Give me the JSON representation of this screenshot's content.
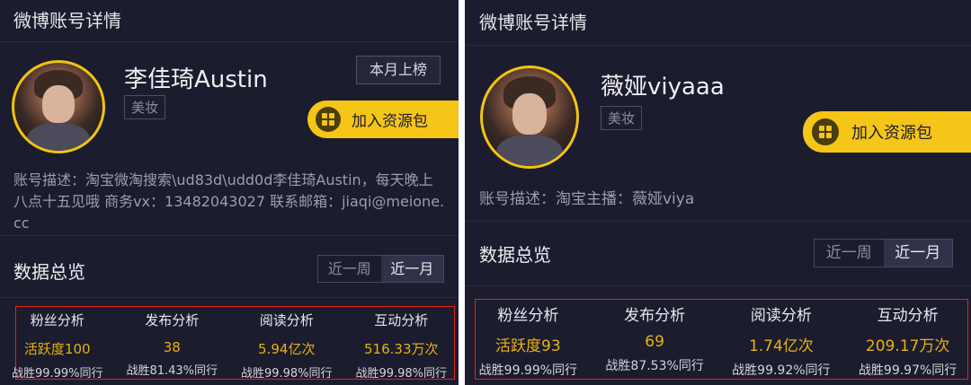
{
  "left": {
    "title": "微博账号详情",
    "name": "李佳琦Austin",
    "tag": "美妆",
    "rank_button": "本月上榜",
    "resource_button": "加入资源包",
    "description": "账号描述：淘宝微淘搜索\\ud83d\\udd0d李佳琦Austin，每天晚上八点十五见哦 商务vx：13482043027 联系邮箱：jiaqi@meione.cc",
    "overview_title": "数据总览",
    "toggle": [
      "近一周",
      "近一月"
    ],
    "toggle_selected": "近一月",
    "stats": [
      {
        "label": "粉丝分析",
        "value": "活跃度100",
        "sub": "战胜99.99%同行"
      },
      {
        "label": "发布分析",
        "value": "38",
        "sub": "战胜81.43%同行"
      },
      {
        "label": "阅读分析",
        "value": "5.94亿次",
        "sub": "战胜99.98%同行"
      },
      {
        "label": "互动分析",
        "value": "516.33万次",
        "sub": "战胜99.98%同行"
      }
    ]
  },
  "right": {
    "title": "微博账号详情",
    "name": "薇娅viyaaa",
    "tag": "美妆",
    "resource_button": "加入资源包",
    "description": "账号描述：淘宝主播：薇娅viya",
    "overview_title": "数据总览",
    "toggle": [
      "近一周",
      "近一月"
    ],
    "toggle_selected": "近一月",
    "stats": [
      {
        "label": "粉丝分析",
        "value": "活跃度93",
        "sub": "战胜99.99%同行"
      },
      {
        "label": "发布分析",
        "value": "69",
        "sub": "战胜87.53%同行"
      },
      {
        "label": "阅读分析",
        "value": "1.74亿次",
        "sub": "战胜99.92%同行"
      },
      {
        "label": "互动分析",
        "value": "209.17万次",
        "sub": "战胜99.97%同行"
      }
    ]
  },
  "colors": {
    "background": "#1b1c2e",
    "accent_yellow": "#f5c518",
    "value_gold": "#e8b20e",
    "highlight_red": "#e5231b"
  }
}
